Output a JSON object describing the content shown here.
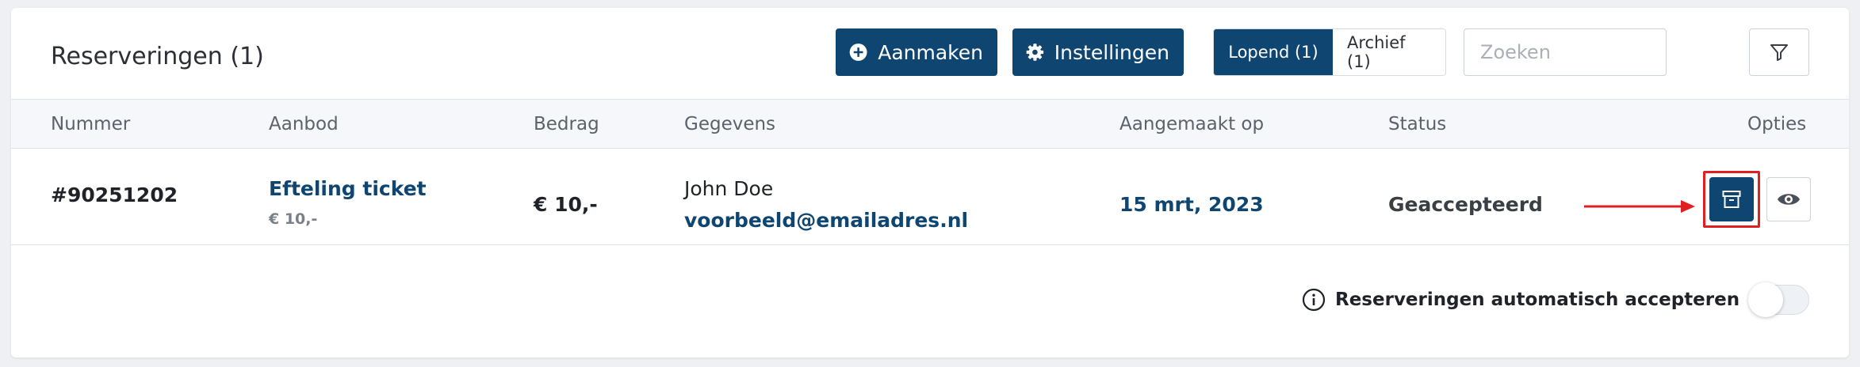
{
  "header": {
    "title": "Reserveringen (1)",
    "create_label": "Aanmaken",
    "settings_label": "Instellingen",
    "tabs": [
      {
        "label": "Lopend (1)",
        "active": true
      },
      {
        "label": "Archief (1)",
        "active": false
      }
    ],
    "search": {
      "placeholder": "Zoeken",
      "value": ""
    },
    "icons": {
      "create": "plus-circle-icon",
      "settings": "gear-icon",
      "filter": "filter-icon"
    }
  },
  "table": {
    "columns": [
      "Nummer",
      "Aanbod",
      "Bedrag",
      "Gegevens",
      "Aangemaakt op",
      "Status",
      "Opties"
    ],
    "rows": [
      {
        "number": "#90251202",
        "offer_title": "Efteling ticket",
        "offer_price": "€ 10,-",
        "amount": "€ 10,-",
        "name": "John Doe",
        "email": "voorbeeld@emailadres.nl",
        "created": "15 mrt, 2023",
        "status": "Geaccepteerd",
        "actions": [
          "archive-icon",
          "eye-icon"
        ]
      }
    ]
  },
  "footer": {
    "auto_accept_label": "Reserveringen automatisch accepteren",
    "auto_accept_enabled": false,
    "icon": "info-icon"
  },
  "colors": {
    "primary": "#0f4571",
    "highlight": "#e02020",
    "background": "#eef0f3"
  }
}
